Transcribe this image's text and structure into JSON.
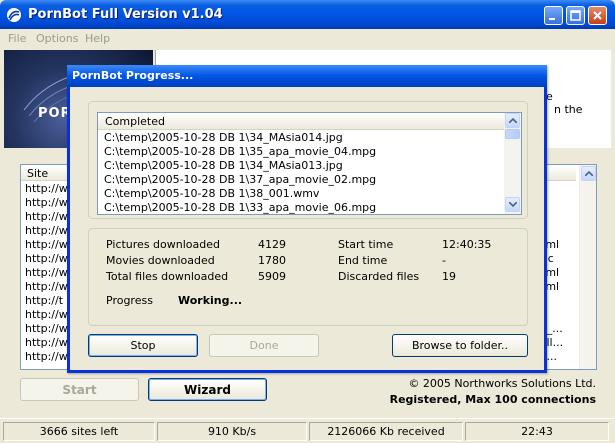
{
  "app": {
    "title": "PornBot Full Version v1.04"
  },
  "menu": {
    "file": "File",
    "options": "Options",
    "help": "Help"
  },
  "banner": {
    "logo_text": "PORN"
  },
  "info": {
    "line1": "e",
    "line2": "n the"
  },
  "site_list": {
    "header": "Site",
    "rows": [
      "http://w",
      "http://w",
      "http://w",
      "http://w",
      "http://w",
      "http://w",
      "http://w",
      "http://w",
      "http://t",
      "http://w",
      "http://w",
      "http://w",
      "http://w"
    ],
    "right_rows": [
      "",
      "",
      "",
      "",
      "tml",
      "ac",
      "tml",
      "tml",
      "",
      "",
      "s_...",
      "_ll...",
      "_..."
    ]
  },
  "buttons": {
    "start": "Start",
    "wizard": "Wizard"
  },
  "footer": {
    "copyright": "© 2005 Northworks Solutions Ltd.",
    "registered": "Registered, Max 100 connections"
  },
  "status": {
    "sites_left": "3666 sites left",
    "speed": "910 Kb/s",
    "received": "2126066 Kb received",
    "time": "22:43"
  },
  "dialog": {
    "title": "PornBot Progress...",
    "files_header": "Completed",
    "files": [
      "C:\\temp\\2005-10-28 DB 1\\34_MAsia014.jpg",
      "C:\\temp\\2005-10-28 DB 1\\35_apa_movie_04.mpg",
      "C:\\temp\\2005-10-28 DB 1\\34_MAsia013.jpg",
      "C:\\temp\\2005-10-28 DB 1\\37_apa_movie_02.mpg",
      "C:\\temp\\2005-10-28 DB 1\\38_001.wmv",
      "C:\\temp\\2005-10-28 DB 1\\33_apa_movie_06.mpg"
    ],
    "stats": {
      "pictures_label": "Pictures downloaded",
      "pictures_value": "4129",
      "movies_label": "Movies downloaded",
      "movies_value": "1780",
      "total_label": "Total files downloaded",
      "total_value": "5909",
      "start_label": "Start time",
      "start_value": "12:40:35",
      "end_label": "End time",
      "end_value": "-",
      "discarded_label": "Discarded files",
      "discarded_value": "19",
      "progress_label": "Progress",
      "progress_value": "Working..."
    },
    "buttons": {
      "stop": "Stop",
      "done": "Done",
      "browse": "Browse to folder.."
    }
  },
  "colors": {
    "titlebar": "#0055e5",
    "face": "#ece9d8",
    "dialog_border": "#0831d9"
  }
}
